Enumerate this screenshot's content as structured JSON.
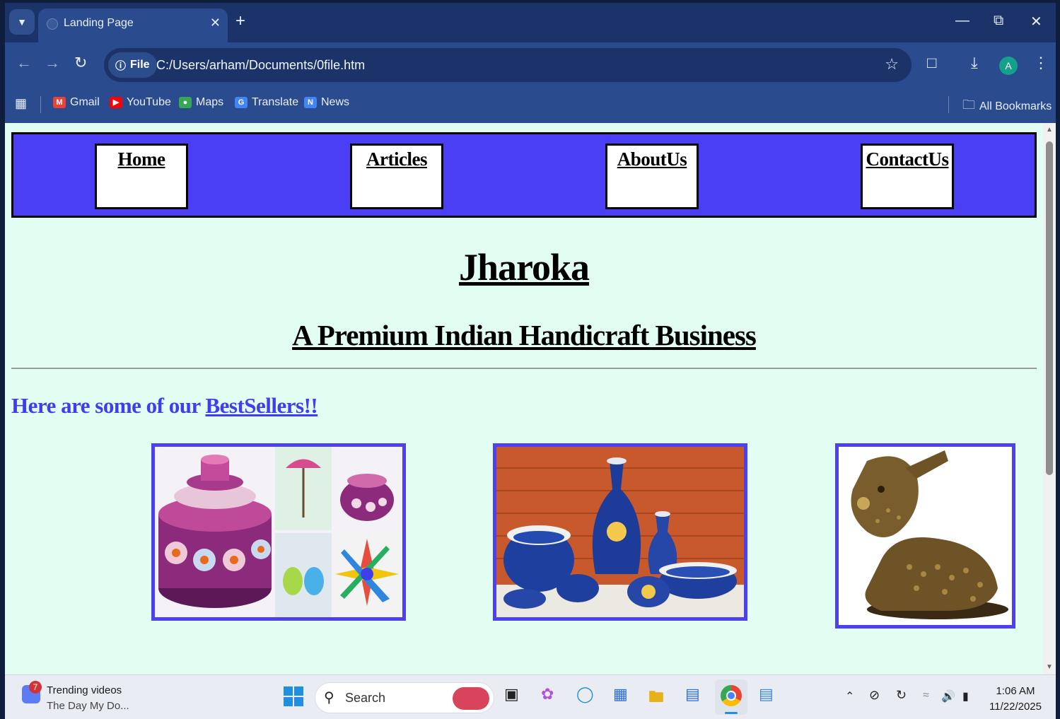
{
  "browser": {
    "tab_title": "Landing Page",
    "url_scheme": "File",
    "url": "C:/Users/arham/Documents/0file.htm",
    "avatar_letter": "A",
    "bookmarks": [
      {
        "label": "Gmail",
        "icon": "gmail-icon",
        "color": "#ea4335"
      },
      {
        "label": "YouTube",
        "icon": "youtube-icon",
        "color": "#ff0000"
      },
      {
        "label": "Maps",
        "icon": "maps-icon",
        "color": "#34a853"
      },
      {
        "label": "Translate",
        "icon": "translate-icon",
        "color": "#4285f4"
      },
      {
        "label": "News",
        "icon": "news-icon",
        "color": "#4285f4"
      }
    ],
    "all_bookmarks": "All Bookmarks"
  },
  "page": {
    "nav": [
      "Home",
      "Articles",
      "AboutUs",
      "ContactUs"
    ],
    "title": "Jharoka",
    "subtitle": "A Premium Indian Handicraft Business",
    "bestsellers_prefix": "Here are some of our ",
    "bestsellers_link": "BestSellers!!",
    "colors": {
      "nav_bg": "#4b3ff5",
      "page_bg": "#e2fdf2",
      "accent": "#3d3ef0"
    }
  },
  "taskbar": {
    "news_badge": "7",
    "news_title": "Trending videos",
    "news_sub": "The Day My Do...",
    "search": "Search",
    "time": "1:06 AM",
    "date": "11/22/2025"
  }
}
